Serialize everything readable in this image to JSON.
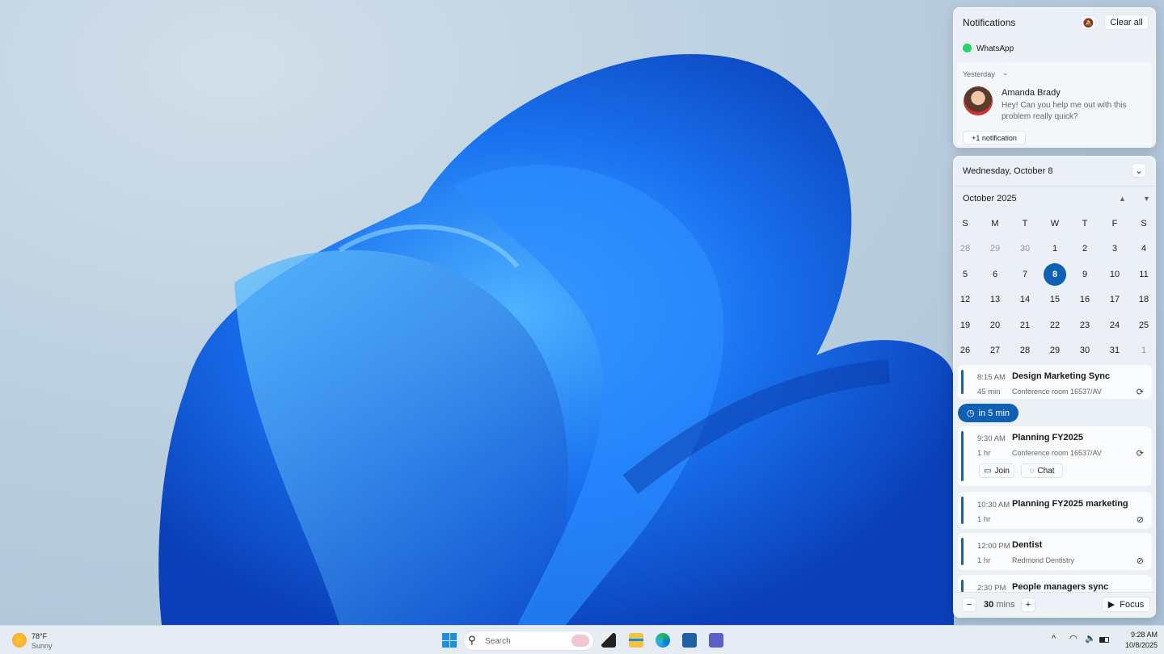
{
  "notifications": {
    "title": "Notifications",
    "clear_all": "Clear all",
    "app": "WhatsApp",
    "group_label": "Yesterday",
    "item": {
      "sender": "Amanda Brady",
      "message_line1": "Hey! Can you help me out with this",
      "message_line2": "problem really quick?"
    },
    "more": "+1 notification"
  },
  "calendar": {
    "date_header": "Wednesday, October 8",
    "month": "October 2025",
    "weekdays": [
      "S",
      "M",
      "T",
      "W",
      "T",
      "F",
      "S"
    ],
    "weeks": [
      [
        "28",
        "29",
        "30",
        "1",
        "2",
        "3",
        "4"
      ],
      [
        "5",
        "6",
        "7",
        "8",
        "9",
        "10",
        "11"
      ],
      [
        "12",
        "13",
        "14",
        "15",
        "16",
        "17",
        "18"
      ],
      [
        "19",
        "20",
        "21",
        "22",
        "23",
        "24",
        "25"
      ],
      [
        "26",
        "27",
        "28",
        "29",
        "30",
        "31",
        "1"
      ]
    ],
    "selected": "8"
  },
  "events": [
    {
      "time": "8:15 AM",
      "title": "Design Marketing Sync",
      "duration": "45 min",
      "location": "Conference room 16537/AV",
      "icon": "recurring-icon"
    },
    {
      "time": "9:30 AM",
      "title": "Planning FY2025",
      "duration": "1 hr",
      "location": "Conference room 16537/AV",
      "icon": "recurring-icon",
      "join": "Join",
      "chat": "Chat"
    },
    {
      "time": "10:30 AM",
      "title": "Planning FY2025 marketing",
      "duration": "1 hr",
      "location": "",
      "icon": "recurring-off-icon"
    },
    {
      "time": "12:00 PM",
      "title": "Dentist",
      "duration": "1 hr",
      "location": "Redmond Dentistry",
      "icon": "recurring-off-icon"
    },
    {
      "time": "2:30 PM",
      "title": "People managers sync"
    }
  ],
  "upcoming_badge": "in 5 min",
  "focus": {
    "minutes": "30",
    "unit": "mins",
    "label": "Focus"
  },
  "taskbar": {
    "weather_temp": "78°F",
    "weather_desc": "Sunny",
    "search_placeholder": "Search",
    "time": "9:28 AM",
    "date": "10/8/2025"
  },
  "colors": {
    "accent": "#0f5fb3"
  }
}
